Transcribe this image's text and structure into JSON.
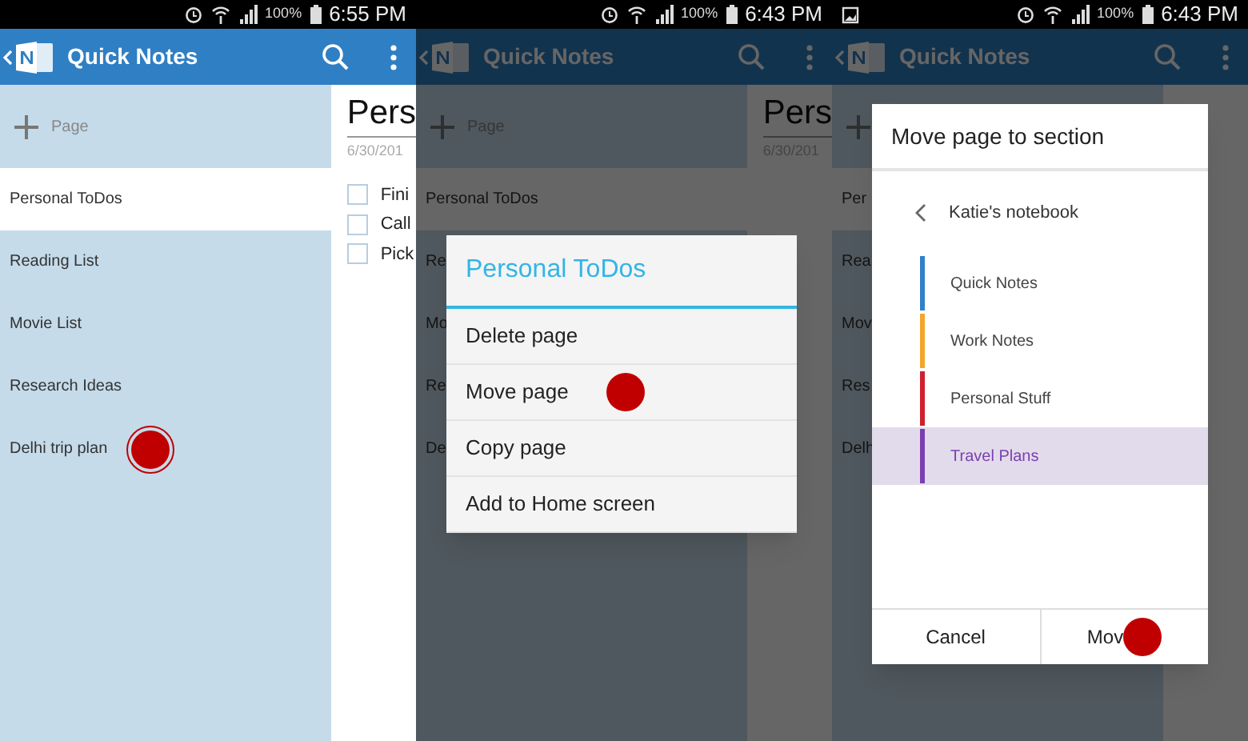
{
  "screens": [
    {
      "status": {
        "time": "6:55 PM",
        "battery": "100%"
      },
      "app_bar": {
        "title": "Quick Notes"
      },
      "add_page": {
        "label": "Page"
      },
      "dimmed": false,
      "pages": [
        {
          "title": "Personal ToDos",
          "selected": true,
          "tap": false
        },
        {
          "title": "Reading List",
          "selected": false,
          "tap": false
        },
        {
          "title": "Movie List",
          "selected": false,
          "tap": false
        },
        {
          "title": "Research Ideas",
          "selected": false,
          "tap": false
        },
        {
          "title": "Delhi trip plan",
          "selected": false,
          "tap": true
        }
      ],
      "note": {
        "title": "Pers",
        "date": "6/30/201",
        "todos": [
          {
            "text": "Fini",
            "checked": false
          },
          {
            "text": "Call",
            "checked": false
          },
          {
            "text": "Pick",
            "checked": false
          }
        ]
      }
    },
    {
      "status": {
        "time": "6:43 PM",
        "battery": "100%"
      },
      "app_bar": {
        "title": "Quick Notes"
      },
      "add_page": {
        "label": "Page"
      },
      "dimmed": true,
      "pages": [
        {
          "title": "Personal ToDos",
          "selected": true,
          "tap": false
        },
        {
          "title": "Re",
          "selected": false,
          "tap": false
        },
        {
          "title": "Mo",
          "selected": false,
          "tap": false
        },
        {
          "title": "Re",
          "selected": false,
          "tap": false
        },
        {
          "title": "De",
          "selected": false,
          "tap": false
        }
      ],
      "note": {
        "title": "Pers",
        "date": "6/30/201"
      },
      "dialog": {
        "kind": "menu",
        "title": "Personal ToDos",
        "items": [
          {
            "label": "Delete page",
            "tap": false
          },
          {
            "label": "Move page",
            "tap": true
          },
          {
            "label": "Copy page",
            "tap": false
          },
          {
            "label": "Add to Home screen",
            "tap": false
          }
        ]
      }
    },
    {
      "status": {
        "time": "6:43 PM",
        "battery": "100%",
        "notifications": [
          {
            "kind": "image"
          }
        ]
      },
      "app_bar": {
        "title": "Quick Notes"
      },
      "dimmed": true,
      "pages": [
        {
          "title": "Per",
          "selected": true,
          "tap": false
        },
        {
          "title": "Rea",
          "selected": false,
          "tap": false
        },
        {
          "title": "Mov",
          "selected": false,
          "tap": false
        },
        {
          "title": "Res",
          "selected": false,
          "tap": false
        },
        {
          "title": "Delh",
          "selected": false,
          "tap": false
        }
      ],
      "dialog": {
        "kind": "picker",
        "title": "Move page to section",
        "notebook": "Katie's notebook",
        "sections": [
          {
            "label": "Quick Notes",
            "color": "#2f80c8",
            "selected": false
          },
          {
            "label": "Work Notes",
            "color": "#f4a62a",
            "selected": false
          },
          {
            "label": "Personal Stuff",
            "color": "#d0202e",
            "selected": false
          },
          {
            "label": "Travel Plans",
            "color": "#7a3fb0",
            "selected": true
          }
        ],
        "buttons": [
          {
            "label": "Cancel",
            "tap": false
          },
          {
            "label": "Mov",
            "tap": true
          }
        ]
      }
    }
  ]
}
